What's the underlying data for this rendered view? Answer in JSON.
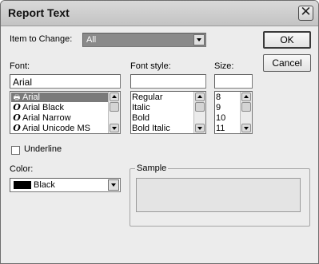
{
  "window": {
    "title": "Report Text",
    "close_glyph": "✕"
  },
  "item_to_change": {
    "label": "Item to Change:",
    "value": "All"
  },
  "buttons": {
    "ok": "OK",
    "cancel": "Cancel"
  },
  "font": {
    "label": "Font:",
    "value": "Arial",
    "items": [
      {
        "name": "Arial",
        "icon": "printer-font-icon",
        "glyph": "🖶",
        "selected": true
      },
      {
        "name": "Arial Black",
        "icon": "opentype-font-icon",
        "glyph": "O",
        "selected": false
      },
      {
        "name": "Arial Narrow",
        "icon": "opentype-font-icon",
        "glyph": "O",
        "selected": false
      },
      {
        "name": "Arial Unicode MS",
        "icon": "opentype-font-icon",
        "glyph": "O",
        "selected": false
      }
    ]
  },
  "font_style": {
    "label": "Font style:",
    "value": "",
    "items": [
      "Regular",
      "Italic",
      "Bold",
      "Bold Italic"
    ]
  },
  "size": {
    "label": "Size:",
    "value": "",
    "items": [
      "8",
      "9",
      "10",
      "11"
    ]
  },
  "underline": {
    "label": "Underline",
    "checked": false
  },
  "color": {
    "label": "Color:",
    "value": "Black",
    "swatch": "#000000"
  },
  "sample": {
    "label": "Sample"
  },
  "colors": {
    "window_bg": "#ececec",
    "selection": "#7a7a7a",
    "disabled_combo": "#8a8a8a"
  }
}
